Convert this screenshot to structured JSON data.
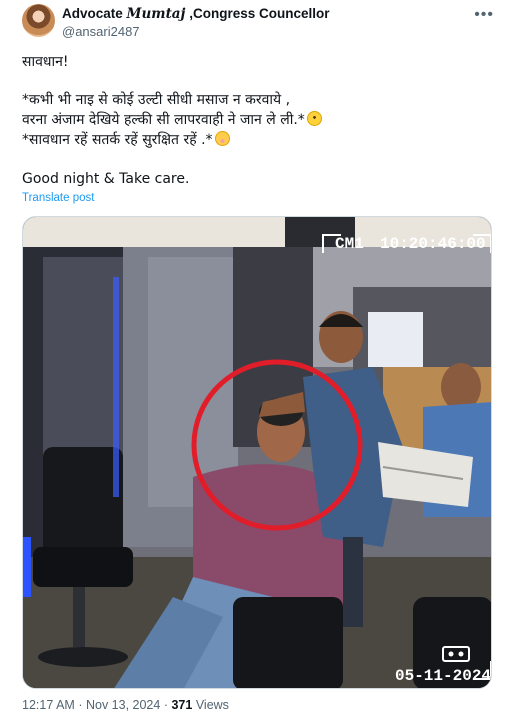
{
  "author": {
    "display_name_prefix": "Advocate ",
    "display_name_fancy": "Mumtaj",
    "display_name_suffix": " ,Congress Councellor",
    "handle": "@ansari2487"
  },
  "more_icon": "more-horizontal-icon",
  "tweet": {
    "line1": "सावधान!",
    "line2": "*कभी भी नाइ से कोई उल्टी सीधी मसाज न करवाये ,",
    "line3": "वरना अंजाम देखिये हल्की सी लापरवाही ने जान ले ली.*",
    "line4": "*सावधान रहें सतर्क रहें सुरक्षित रहें .*",
    "line5": "Good night & Take care."
  },
  "emojis": [
    "face-screaming-in-fear",
    "flushed-face"
  ],
  "translate_label": "Translate post",
  "media": {
    "cctv_camera": "CM1",
    "cctv_time": "10:20:46:00",
    "cctv_date": "05-11-2024",
    "highlight_color": "#e11d2a"
  },
  "meta": {
    "time": "12:17 AM",
    "date": "Nov 13, 2024",
    "separator": "·",
    "views_count": "371",
    "views_label": "Views"
  }
}
